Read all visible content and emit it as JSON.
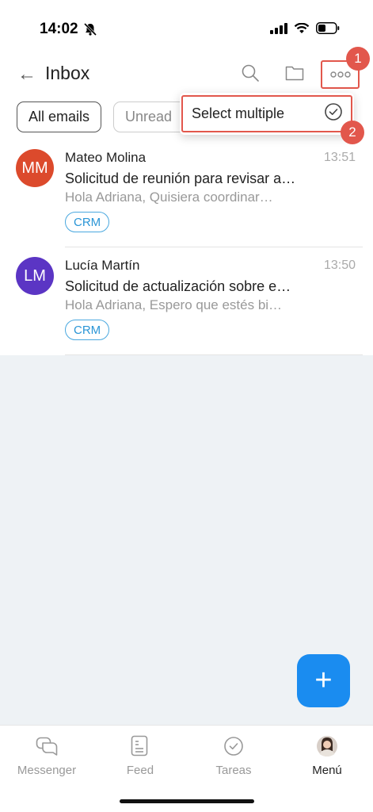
{
  "status_bar": {
    "time": "14:02"
  },
  "header": {
    "back_icon": "←",
    "title": "Inbox"
  },
  "filters": {
    "all": "All emails",
    "unread": "Unread"
  },
  "dropdown": {
    "select_multiple": "Select multiple"
  },
  "badges": {
    "one": "1",
    "two": "2"
  },
  "emails": [
    {
      "initials": "MM",
      "avatar_color": "#dc4a2c",
      "sender": "Mateo Molina",
      "time": "13:51",
      "subject": "Solicitud de reunión para revisar a…",
      "preview": "Hola Adriana, Quisiera coordinar…",
      "tag": "CRM"
    },
    {
      "initials": "LM",
      "avatar_color": "#5b35c4",
      "sender": "Lucía Martín",
      "time": "13:50",
      "subject": "Solicitud de actualización sobre e…",
      "preview": "Hola Adriana, Espero que estés bi…",
      "tag": "CRM"
    }
  ],
  "fab": {
    "icon": "+"
  },
  "nav": {
    "messenger": "Messenger",
    "feed": "Feed",
    "tareas": "Tareas",
    "menu": "Menú"
  },
  "colors": {
    "accent": "#1a8cf0",
    "highlight": "#e2574c",
    "tag": "#2a95d6"
  }
}
